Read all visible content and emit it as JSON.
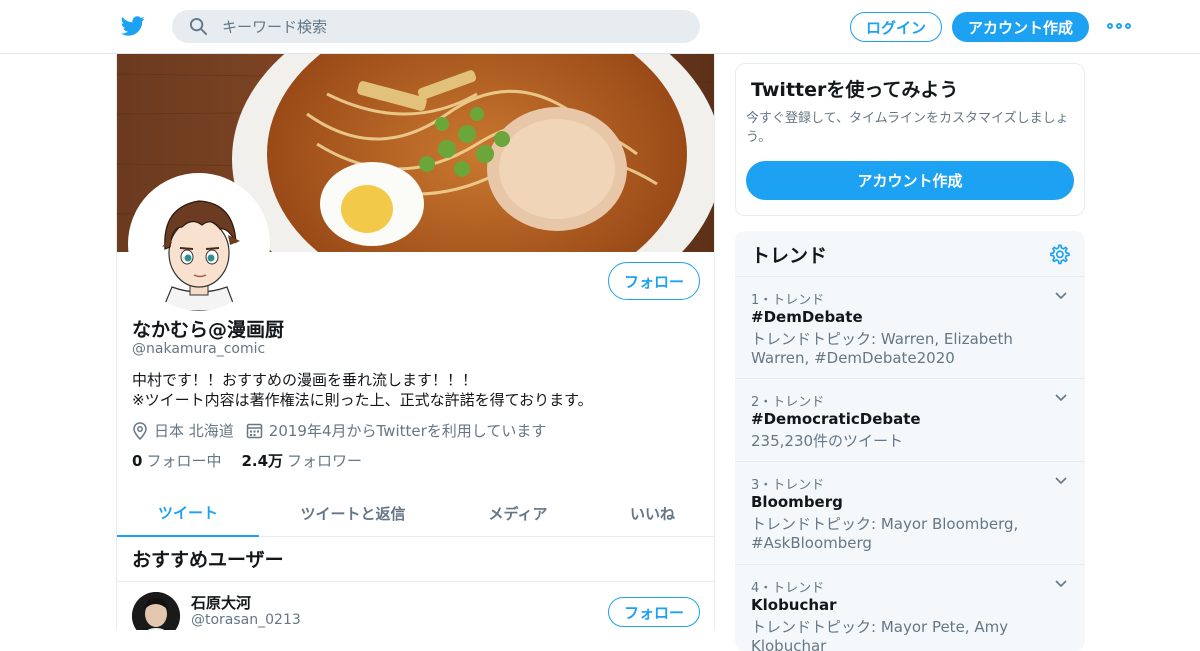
{
  "header": {
    "logo_icon": "twitter-bird-icon",
    "search_placeholder": "キーワード検索",
    "login_label": "ログイン",
    "signup_label": "アカウント作成",
    "more_icon": "more-dots-icon",
    "accent_color": "#1da1f2"
  },
  "profile": {
    "name": "なかむら@漫画厨",
    "handle": "@nakamura_comic",
    "follow_label": "フォロー",
    "bio_line1": "中村です！！おすすめの漫画を垂れ流します！！！",
    "bio_line2": "※ツイート内容は著作権法に則った上、正式な許諾を得ております。",
    "location": "日本 北海道",
    "joined": "2019年4月からTwitterを利用しています",
    "following_count": "0",
    "following_label": "フォロー中",
    "followers_count": "2.4万",
    "followers_label": "フォロワー"
  },
  "tabs": [
    {
      "label": "ツイート"
    },
    {
      "label": "ツイートと返信"
    },
    {
      "label": "メディア"
    },
    {
      "label": "いいね"
    }
  ],
  "recommend": {
    "title": "おすすめユーザー",
    "users": [
      {
        "name": "石原大河",
        "handle": "@torasan_0213",
        "follow_label": "フォロー"
      }
    ]
  },
  "signup_card": {
    "title": "Twitterを使ってみよう",
    "description": "今すぐ登録して、タイムラインをカスタマイズしましょう。",
    "button_label": "アカウント作成"
  },
  "trends": {
    "title": "トレンド",
    "settings_icon": "gear-icon",
    "items": [
      {
        "rank": "1・トレンド",
        "name": "#DemDebate",
        "desc": "トレンドトピック: Warren, Elizabeth Warren, #DemDebate2020"
      },
      {
        "rank": "2・トレンド",
        "name": "#DemocraticDebate",
        "desc": "235,230件のツイート"
      },
      {
        "rank": "3・トレンド",
        "name": "Bloomberg",
        "desc": "トレンドトピック: Mayor Bloomberg, #AskBloomberg"
      },
      {
        "rank": "4・トレンド",
        "name": "Klobuchar",
        "desc": "トレンドトピック: Mayor Pete, Amy Klobuchar"
      }
    ]
  }
}
